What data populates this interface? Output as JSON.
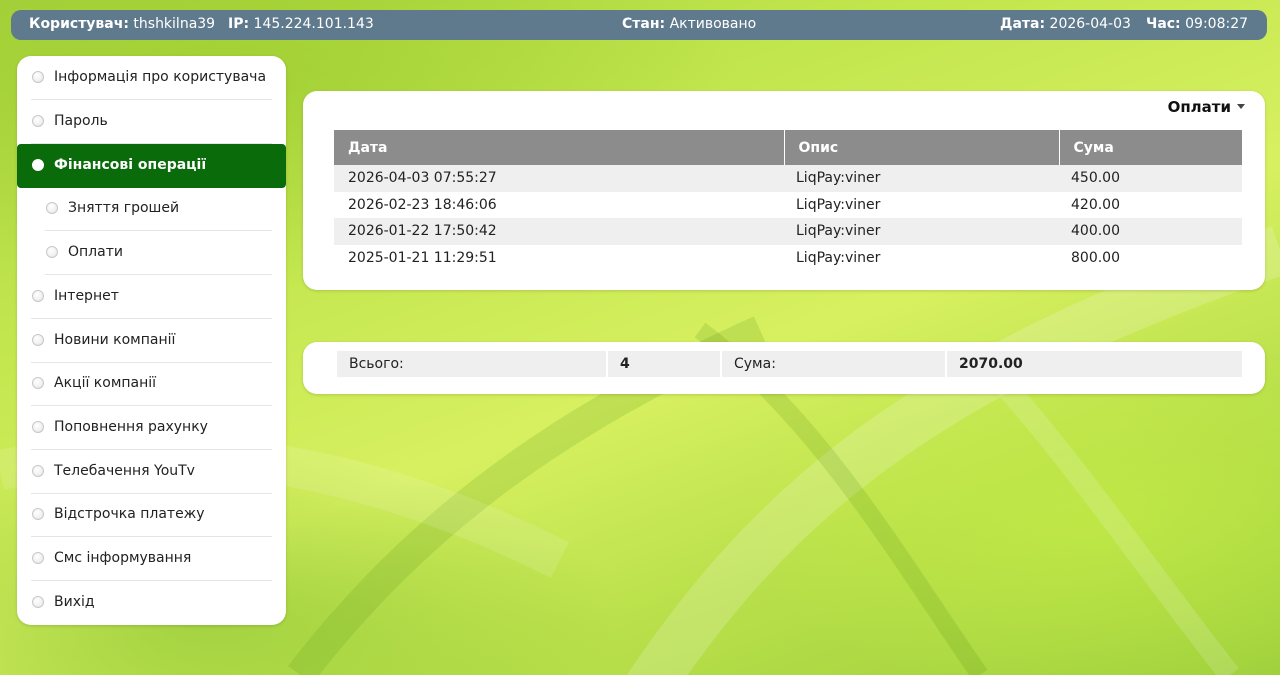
{
  "topbar": {
    "user_label": "Користувач:",
    "user_value": "thshkilna39",
    "ip_label": "IP:",
    "ip_value": "145.224.101.143",
    "state_label": "Стан:",
    "state_value": "Активовано",
    "date_label": "Дата:",
    "date_value": "2026-04-03",
    "time_label": "Час:",
    "time_value": "09:08:27"
  },
  "sidebar": {
    "items": [
      {
        "label": "Інформація про користувача"
      },
      {
        "label": "Пароль"
      },
      {
        "label": "Фінансові операції"
      },
      {
        "label": "Зняття грошей"
      },
      {
        "label": "Оплати"
      },
      {
        "label": "Інтернет"
      },
      {
        "label": "Новини компанії"
      },
      {
        "label": "Акції компанії"
      },
      {
        "label": "Поповнення рахунку"
      },
      {
        "label": "Телебачення YouTv"
      },
      {
        "label": "Відстрочка платежу"
      },
      {
        "label": "Смс інформування"
      },
      {
        "label": "Вихід"
      }
    ],
    "active_index": 2
  },
  "payments": {
    "title": "Оплати",
    "columns": [
      "Дата",
      "Опис",
      "Сума"
    ],
    "rows": [
      {
        "date": "2026-04-03 07:55:27",
        "description": "LiqPay:viner",
        "amount": "450.00"
      },
      {
        "date": "2026-02-23 18:46:06",
        "description": "LiqPay:viner",
        "amount": "420.00"
      },
      {
        "date": "2026-01-22 17:50:42",
        "description": "LiqPay:viner",
        "amount": "400.00"
      },
      {
        "date": "2025-01-21 11:29:51",
        "description": "LiqPay:viner",
        "amount": "800.00"
      }
    ]
  },
  "totals": {
    "count_label": "Всього:",
    "count_value": "4",
    "sum_label": "Сума:",
    "sum_value": "2070.00"
  },
  "colors": {
    "topbar": "#5f7a8d",
    "active_menu": "#0a6b0a",
    "table_header": "#8c8c8c",
    "row_stripe": "#efefef"
  }
}
